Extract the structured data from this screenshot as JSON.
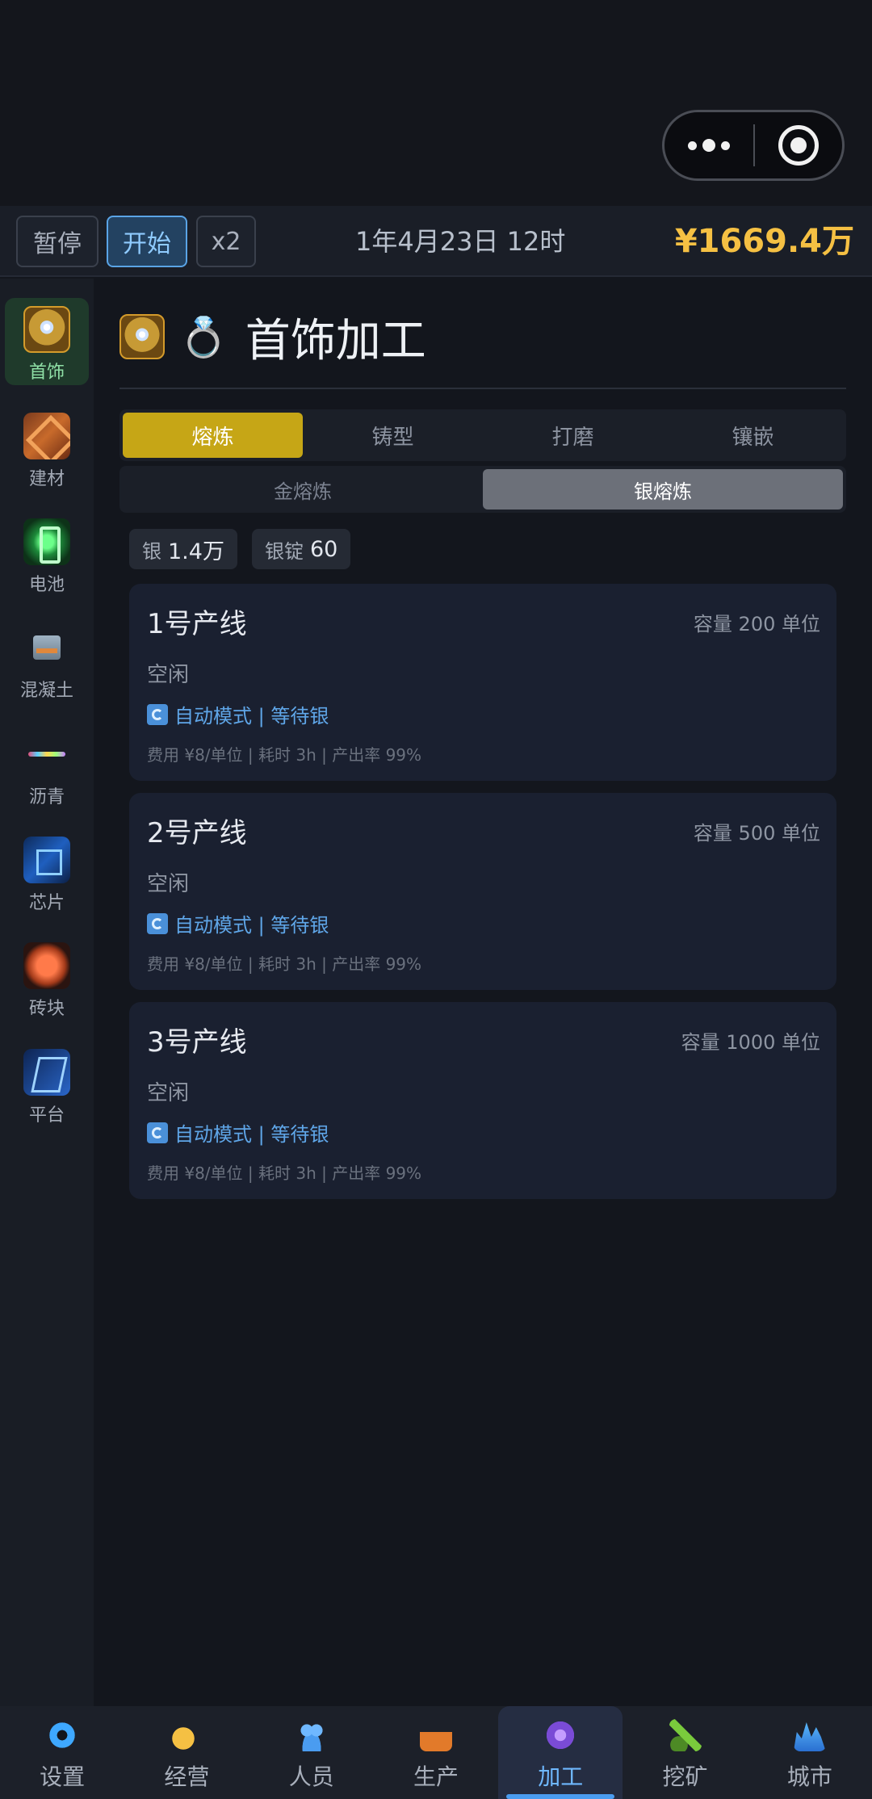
{
  "controls": {
    "pause": "暂停",
    "start": "开始",
    "speed": "x2",
    "date": "1年4月23日 12时",
    "money": "¥1669.4万"
  },
  "sidebar": {
    "items": [
      {
        "label": "首饰",
        "icon": "jewelry-icon",
        "active": true
      },
      {
        "label": "建材",
        "icon": "building-material-icon"
      },
      {
        "label": "电池",
        "icon": "battery-icon"
      },
      {
        "label": "混凝土",
        "icon": "concrete-icon"
      },
      {
        "label": "沥青",
        "icon": "asphalt-icon"
      },
      {
        "label": "芯片",
        "icon": "chip-icon"
      },
      {
        "label": "砖块",
        "icon": "brick-icon"
      },
      {
        "label": "平台",
        "icon": "platform-icon"
      }
    ]
  },
  "main": {
    "title": "首饰加工",
    "title_emoji": "💍",
    "tabs": [
      {
        "label": "熔炼",
        "active": true
      },
      {
        "label": "铸型"
      },
      {
        "label": "打磨"
      },
      {
        "label": "镶嵌"
      }
    ],
    "subtabs": [
      {
        "label": "金熔炼"
      },
      {
        "label": "银熔炼",
        "active": true
      }
    ],
    "resources": [
      {
        "name": "银",
        "value": "1.4万"
      },
      {
        "name": "银锭",
        "value": "60"
      }
    ],
    "lines": [
      {
        "name": "1号产线",
        "capacity": "容量 200 单位",
        "state": "空闲",
        "mode": "自动模式 | 等待银",
        "stats": "费用 ¥8/单位 | 耗时 3h | 产出率 99%"
      },
      {
        "name": "2号产线",
        "capacity": "容量 500 单位",
        "state": "空闲",
        "mode": "自动模式 | 等待银",
        "stats": "费用 ¥8/单位 | 耗时 3h | 产出率 99%"
      },
      {
        "name": "3号产线",
        "capacity": "容量 1000 单位",
        "state": "空闲",
        "mode": "自动模式 | 等待银",
        "stats": "费用 ¥8/单位 | 耗时 3h | 产出率 99%"
      }
    ]
  },
  "bottom_nav": {
    "items": [
      {
        "label": "设置",
        "icon": "gear-icon"
      },
      {
        "label": "经营",
        "icon": "business-icon"
      },
      {
        "label": "人员",
        "icon": "people-icon"
      },
      {
        "label": "生产",
        "icon": "factory-icon"
      },
      {
        "label": "加工",
        "icon": "processing-icon",
        "active": true
      },
      {
        "label": "挖矿",
        "icon": "mining-icon"
      },
      {
        "label": "城市",
        "icon": "city-icon"
      }
    ]
  },
  "colors": {
    "accent_gold": "#c6a616",
    "money": "#f5c043",
    "link_blue": "#5fa6e8",
    "nav_active": "#4a9cf0"
  }
}
